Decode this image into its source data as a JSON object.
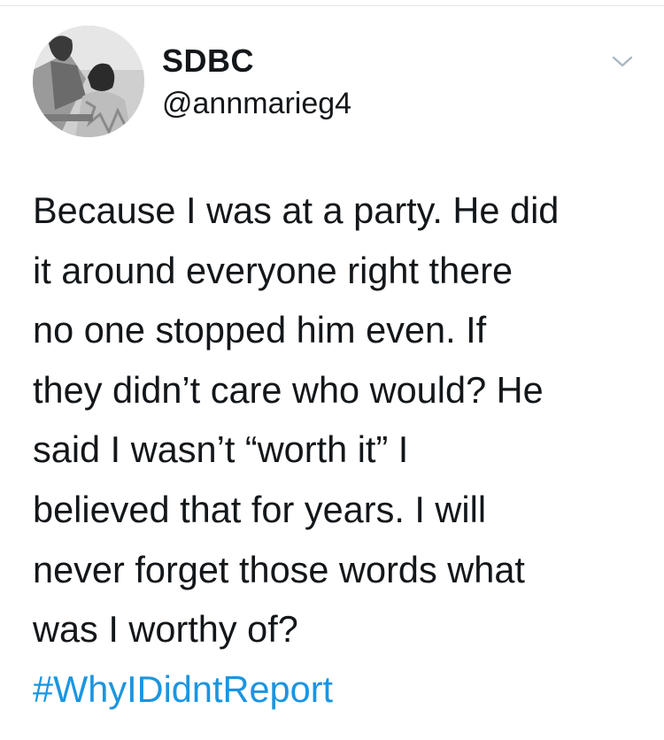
{
  "tweet": {
    "author": {
      "display_name": "SDBC",
      "handle": "@annmarieg4"
    },
    "menu_icon": "chevron-down-icon",
    "text_lines": [
      "Because I was at a party. He did",
      "it around everyone right there",
      "no one stopped him even. If",
      "they didn’t care who would? He",
      "said I wasn’t “worth it” I",
      "believed that for years. I will",
      "never forget those words what",
      "was I worthy of?"
    ],
    "hashtag": "#WhyIDidntReport"
  },
  "colors": {
    "text": "#14171a",
    "link": "#1b95e0",
    "divider": "#e1e8ed",
    "icon": "#aab8c2"
  }
}
